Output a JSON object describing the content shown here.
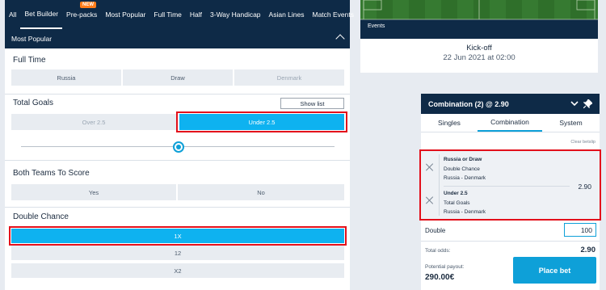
{
  "nav": {
    "tabs": [
      "All",
      "Bet Builder",
      "Pre-packs",
      "Most Popular",
      "Full Time",
      "Half",
      "3-Way Handicap",
      "Asian Lines",
      "Match Events"
    ],
    "badge": "NEW"
  },
  "section": {
    "title": "Most Popular"
  },
  "markets": {
    "full_time": {
      "title": "Full Time",
      "options": [
        "Russia",
        "Draw",
        "Denmark"
      ]
    },
    "total_goals": {
      "title": "Total Goals",
      "show_list": "Show list",
      "over": "Over 2.5",
      "under": "Under 2.5"
    },
    "btts": {
      "title": "Both Teams To Score",
      "yes": "Yes",
      "no": "No"
    },
    "double_chance": {
      "title": "Double Chance",
      "options": [
        "1X",
        "12",
        "X2"
      ]
    }
  },
  "events": {
    "label": "Events",
    "kickoff": "Kick-off",
    "date": "22 Jun 2021 at 02:00"
  },
  "betslip": {
    "title": "Combination (2) @ 2.90",
    "tabs": [
      "Singles",
      "Combination",
      "System"
    ],
    "clear": "Clear betslip",
    "legs": [
      {
        "selection": "Russia or Draw",
        "market": "Double Chance",
        "match": "Russia - Denmark"
      },
      {
        "selection": "Under 2.5",
        "market": "Total Goals",
        "match": "Russia - Denmark"
      }
    ],
    "combo_odds": "2.90",
    "double_label": "Double",
    "stake": "100",
    "total_odds_label": "Total odds:",
    "total_odds": "2.90",
    "payout_label": "Potential payout:",
    "payout": "290.00€",
    "place_bet": "Place bet"
  },
  "colors": {
    "navy": "#0e2a47",
    "selected": "#0eb2f0",
    "highlight": "#e3101b",
    "badge": "#ff7d1a"
  }
}
